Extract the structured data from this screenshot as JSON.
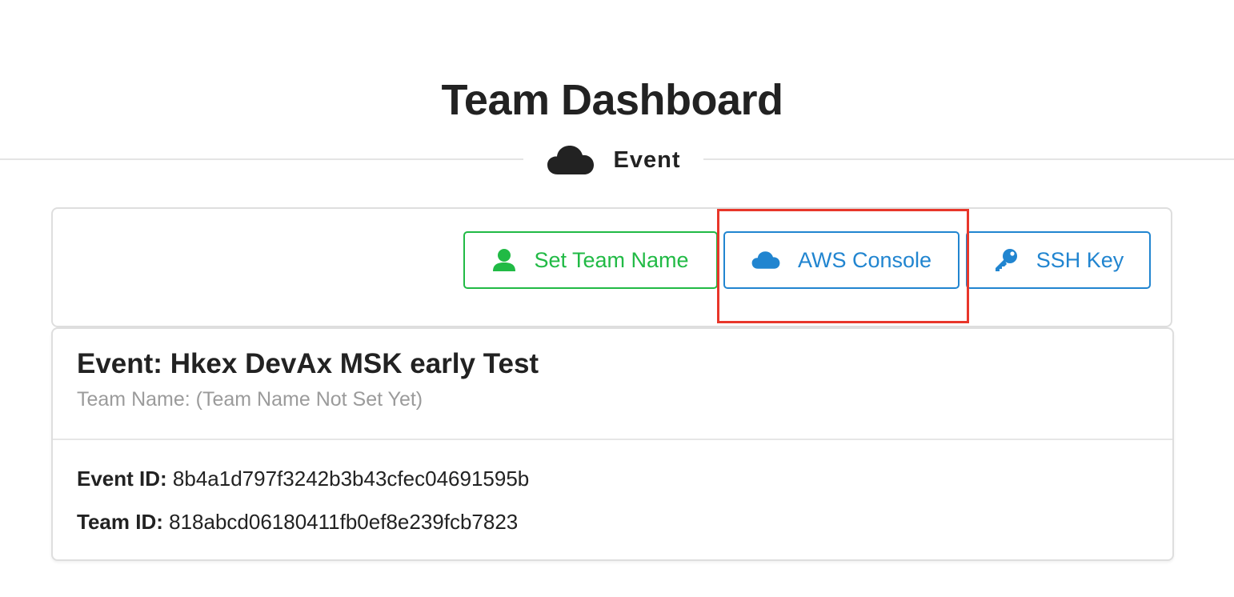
{
  "header": {
    "title": "Team Dashboard"
  },
  "section_divider": {
    "icon": "cloud-icon",
    "label": "Event"
  },
  "toolbar": {
    "set_team_name": {
      "label": "Set Team Name",
      "icon": "user-icon",
      "color": "#21ba45"
    },
    "aws_console": {
      "label": "AWS Console",
      "icon": "cloud-icon",
      "color": "#2185d0"
    },
    "ssh_key": {
      "label": "SSH Key",
      "icon": "key-icon",
      "color": "#2185d0"
    },
    "highlight_color": "#e8362a"
  },
  "event_card": {
    "title": "Event: Hkex DevAx MSK early Test",
    "team_name_line": "Team Name: (Team Name Not Set Yet)",
    "event_id_label": "Event ID:",
    "event_id_value": "8b4a1d797f3242b3b43cfec04691595b",
    "team_id_label": "Team ID:",
    "team_id_value": "818abcd06180411fb0ef8e239fcb7823"
  }
}
